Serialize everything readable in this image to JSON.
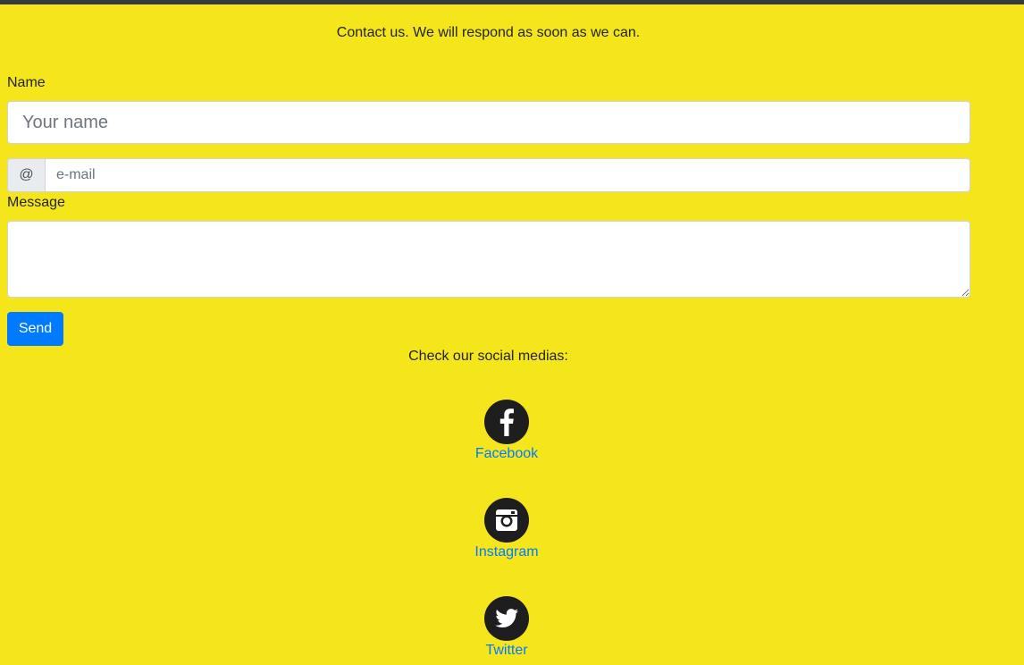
{
  "intro_text": "Contact us. We will respond as soon as we can.",
  "form": {
    "name_label": "Name",
    "name_placeholder": "Your name",
    "name_value": "",
    "email_prefix": "@",
    "email_placeholder": "e-mail",
    "email_value": "",
    "message_label": "Message",
    "message_value": "",
    "send_label": "Send"
  },
  "social": {
    "heading": "Check our social medias:",
    "items": [
      {
        "label": "Facebook",
        "icon": "facebook-icon"
      },
      {
        "label": "Instagram",
        "icon": "instagram-icon"
      },
      {
        "label": "Twitter",
        "icon": "twitter-icon"
      }
    ]
  },
  "colors": {
    "background": "#f5e51b",
    "top_bar": "#343a40",
    "accent": "#007bff",
    "link": "#007bff",
    "icon_circle": "#1e1e1e"
  }
}
